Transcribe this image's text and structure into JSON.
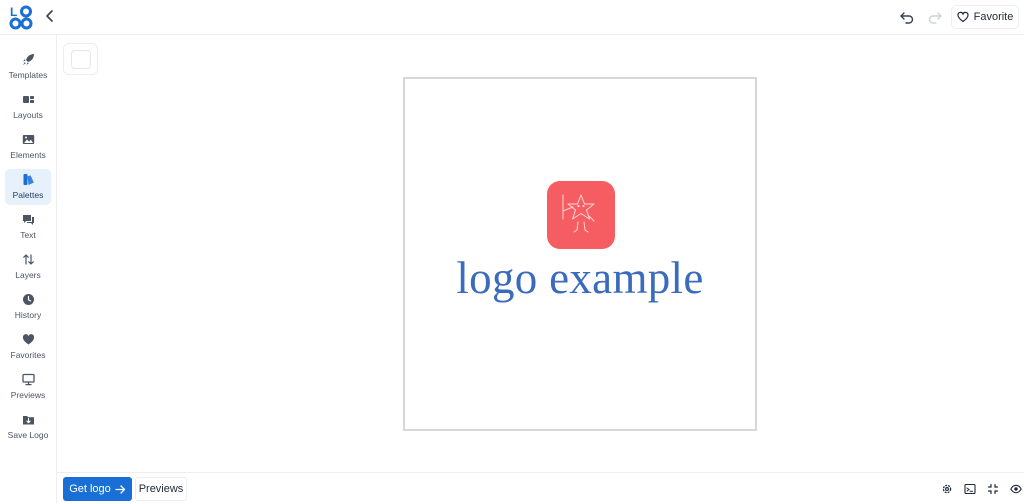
{
  "header": {
    "logo_icon": "logo-brand-icon",
    "back_icon": "chevron-left-icon",
    "undo_icon": "undo-icon",
    "redo_icon": "redo-icon",
    "favorite_label": "Favorite",
    "favorite_icon": "heart-outline-icon"
  },
  "sidebar": {
    "items": [
      {
        "label": "Templates",
        "icon": "rocket-icon"
      },
      {
        "label": "Layouts",
        "icon": "layout-icon"
      },
      {
        "label": "Elements",
        "icon": "image-icon"
      },
      {
        "label": "Palettes",
        "icon": "palette-icon",
        "active": true
      },
      {
        "label": "Text",
        "icon": "chat-icon"
      },
      {
        "label": "Layers",
        "icon": "sort-arrows-icon"
      },
      {
        "label": "History",
        "icon": "clock-icon"
      },
      {
        "label": "Favorites",
        "icon": "heart-icon"
      },
      {
        "label": "Previews",
        "icon": "monitor-icon"
      },
      {
        "label": "Save Logo",
        "icon": "folder-download-icon"
      }
    ]
  },
  "canvas": {
    "logo_text": "logo example",
    "logo_text_color": "#3a6bbd",
    "mark_color": "#f55d62",
    "mark_icon": "star-teacher-icon"
  },
  "footer": {
    "get_logo_label": "Get logo",
    "get_logo_icon": "arrow-right-icon",
    "previews_label": "Previews",
    "tools": [
      "settings-icon",
      "terminal-icon",
      "fullscreen-icon",
      "eye-icon"
    ],
    "accent_color": "#1a6fd6"
  }
}
